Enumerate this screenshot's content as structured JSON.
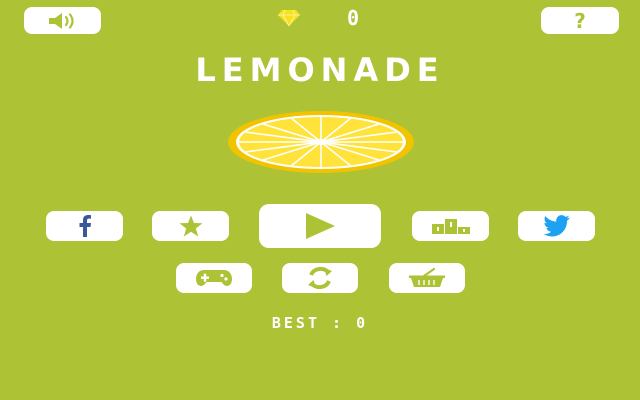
{
  "game": {
    "title": "LEMONADE",
    "gem_count": "0",
    "best_label": "BEST",
    "best_separator": ":",
    "best_score": "0",
    "help_glyph": "?"
  },
  "icons": {
    "sound": "speaker-icon",
    "help": "question-icon",
    "gem": "diamond-icon",
    "lemon": "lemon-slice-icon",
    "facebook": "facebook-icon",
    "rate": "star-icon",
    "play": "play-icon",
    "leaderboard": "podium-icon",
    "twitter": "twitter-bird-icon",
    "games": "gamepad-icon",
    "restore": "rotate-icon",
    "shop": "basket-icon"
  },
  "colors": {
    "background": "#aec236",
    "button_fill": "#ffffff",
    "button_icon": "#aec236",
    "gem": "#f7e21c",
    "lemon_rind": "#f2c400",
    "lemon_flesh": "#ffe23a",
    "facebook": "#3b5998",
    "twitter": "#1da1f2"
  }
}
